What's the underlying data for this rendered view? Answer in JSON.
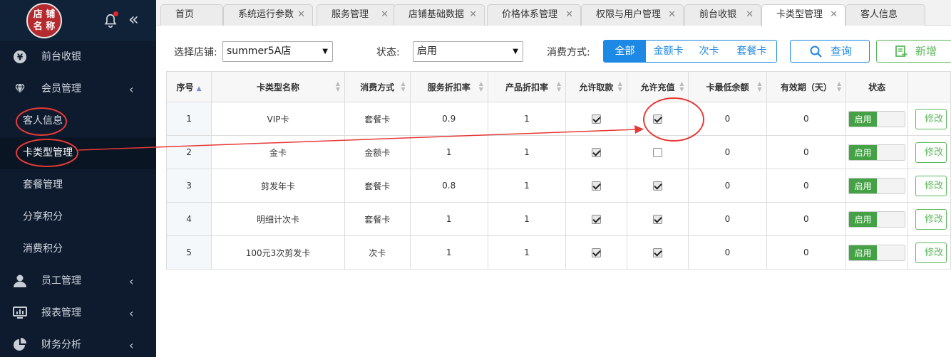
{
  "sidebar": {
    "logo": [
      "店 铺",
      "名 称"
    ],
    "menu": [
      {
        "label": "前台收银",
        "icon": "yen-icon"
      },
      {
        "label": "会员管理",
        "icon": "diamond-icon"
      }
    ],
    "submenu": [
      {
        "label": "客人信息"
      },
      {
        "label": "卡类型管理"
      },
      {
        "label": "套餐管理"
      },
      {
        "label": "分享积分"
      },
      {
        "label": "消费积分"
      }
    ],
    "menu2": [
      {
        "label": "员工管理",
        "icon": "user-icon"
      },
      {
        "label": "报表管理",
        "icon": "monitor-icon"
      },
      {
        "label": "财务分析",
        "icon": "pie-chart-icon"
      }
    ]
  },
  "tabs": [
    {
      "label": "首页"
    },
    {
      "label": "系统运行参数"
    },
    {
      "label": "服务管理"
    },
    {
      "label": "店铺基础数据"
    },
    {
      "label": "价格体系管理"
    },
    {
      "label": "权限与用户管理"
    },
    {
      "label": "前台收银"
    },
    {
      "label": "卡类型管理"
    },
    {
      "label": "客人信息"
    }
  ],
  "filters": {
    "store_label": "选择店铺:",
    "store_value": "summer5A店",
    "status_label": "状态:",
    "status_value": "启用",
    "consume_label": "消费方式:",
    "consume_options": [
      "全部",
      "金额卡",
      "次卡",
      "套餐卡"
    ],
    "search_label": "查询",
    "add_label": "新增"
  },
  "table": {
    "headers": [
      "序号",
      "卡类型名称",
      "消费方式",
      "服务折扣率",
      "产品折扣率",
      "允许取款",
      "允许充值",
      "卡最低余额",
      "有效期（天）",
      "状态",
      ""
    ],
    "rows": [
      {
        "no": "1",
        "name": "VIP卡",
        "mode": "套餐卡",
        "svc": "0.9",
        "prod": "1",
        "withdraw": true,
        "recharge": true,
        "minbal": "0",
        "valid": "0",
        "status": "启用",
        "action": "修改"
      },
      {
        "no": "2",
        "name": "金卡",
        "mode": "金额卡",
        "svc": "1",
        "prod": "1",
        "withdraw": true,
        "recharge": false,
        "minbal": "0",
        "valid": "0",
        "status": "启用",
        "action": "修改"
      },
      {
        "no": "3",
        "name": "剪发年卡",
        "mode": "套餐卡",
        "svc": "0.8",
        "prod": "1",
        "withdraw": true,
        "recharge": true,
        "minbal": "0",
        "valid": "0",
        "status": "启用",
        "action": "修改"
      },
      {
        "no": "4",
        "name": "明细计次卡",
        "mode": "套餐卡",
        "svc": "1",
        "prod": "1",
        "withdraw": true,
        "recharge": true,
        "minbal": "0",
        "valid": "0",
        "status": "启用",
        "action": "修改"
      },
      {
        "no": "5",
        "name": "100元3次剪发卡",
        "mode": "次卡",
        "svc": "1",
        "prod": "1",
        "withdraw": true,
        "recharge": true,
        "minbal": "0",
        "valid": "0",
        "status": "启用",
        "action": "修改"
      }
    ]
  },
  "colors": {
    "sidebar_bg": "#0e1b2f",
    "accent_blue": "#1e88e5",
    "accent_green": "#5cb85c",
    "annotation_red": "#e53935"
  }
}
